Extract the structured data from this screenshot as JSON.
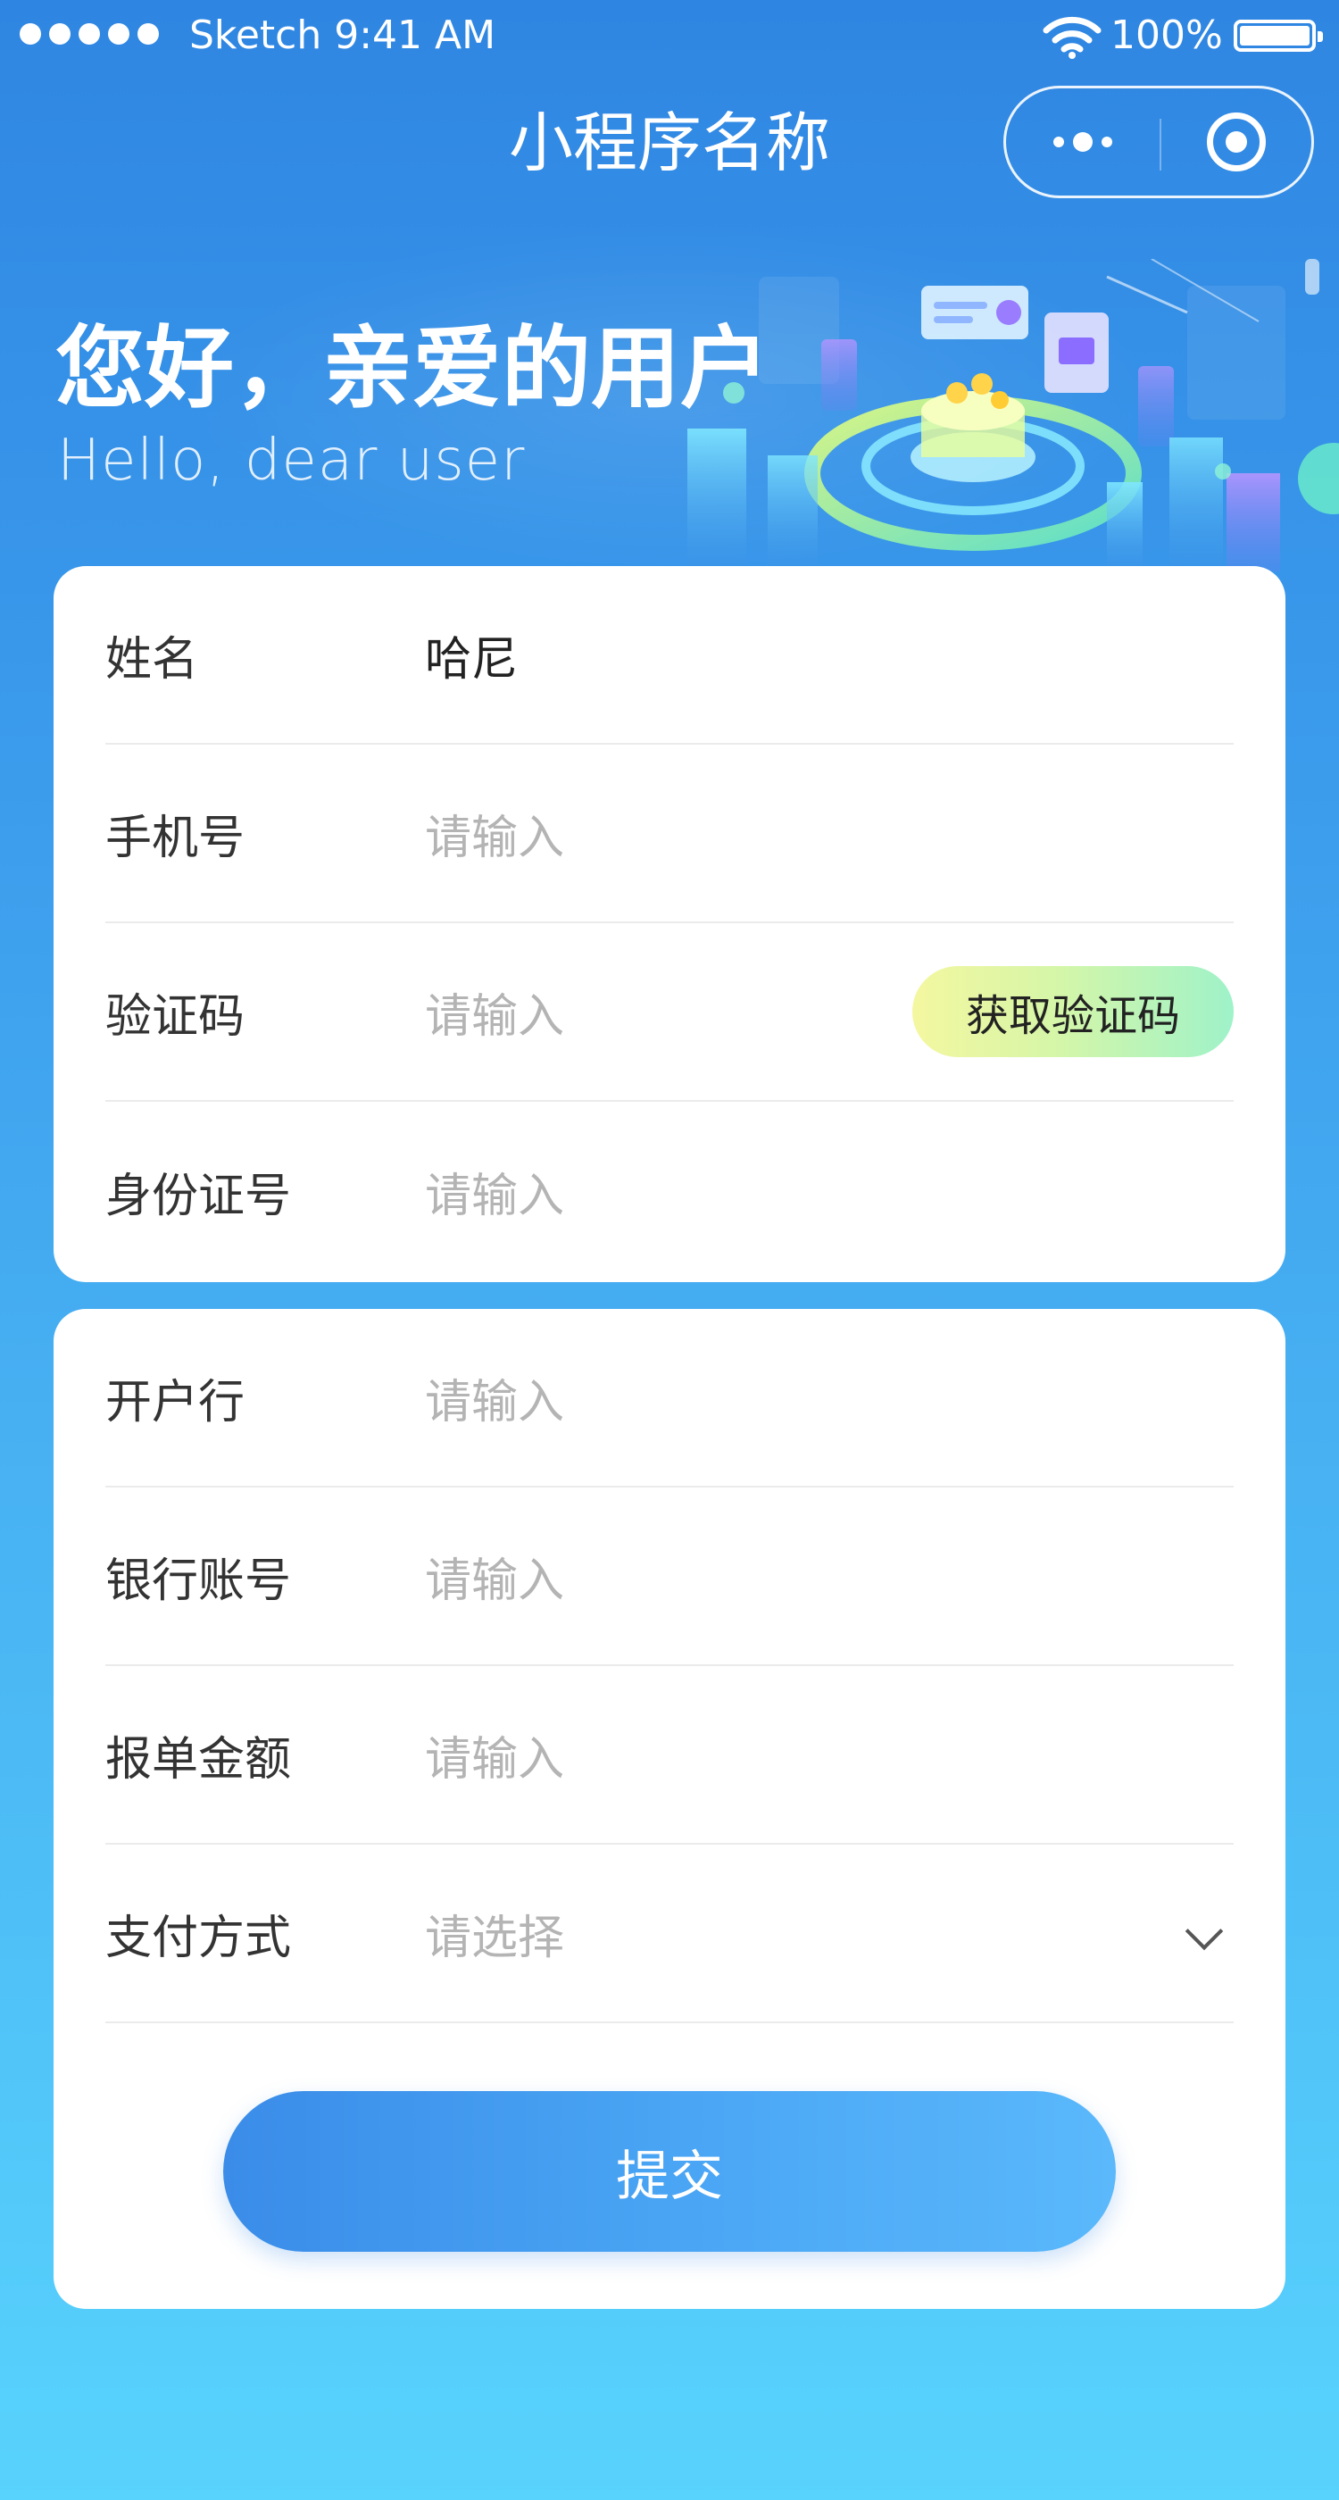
{
  "status_bar": {
    "carrier_time": "Sketch 9:41 AM",
    "battery": "100%",
    "signal_icon": "signal-dots-icon",
    "wifi_icon": "wifi-icon",
    "battery_icon": "battery-icon"
  },
  "nav": {
    "title": "小程序名称",
    "more_icon": "more-dots-icon",
    "close_icon": "target-close-icon"
  },
  "banner": {
    "greeting": "您好，亲爱的用户",
    "greeting_en": "Hello, dear user"
  },
  "form_personal": {
    "rows": [
      {
        "label": "姓名",
        "value": "哈尼",
        "placeholder": ""
      },
      {
        "label": "手机号",
        "value": "",
        "placeholder": "请输入"
      },
      {
        "label": "验证码",
        "value": "",
        "placeholder": "请输入"
      },
      {
        "label": "身份证号",
        "value": "",
        "placeholder": "请输入"
      }
    ],
    "get_code_label": "获取验证码"
  },
  "form_bank": {
    "rows": [
      {
        "label": "开户行",
        "placeholder": "请输入"
      },
      {
        "label": "银行账号",
        "placeholder": "请输入"
      },
      {
        "label": "报单金额",
        "placeholder": "请输入"
      },
      {
        "label": "支付方式",
        "placeholder": "请选择"
      }
    ],
    "submit_label": "提交"
  },
  "colors": {
    "background_top": "#2f86e2",
    "background_bottom": "#58d3fd",
    "button_gradient_start": "#3a8ce8",
    "button_gradient_end": "#5ab8fb",
    "code_button_start": "#f4f7a0",
    "code_button_end": "#9ff2c9",
    "placeholder_text": "#b4b4b4"
  }
}
